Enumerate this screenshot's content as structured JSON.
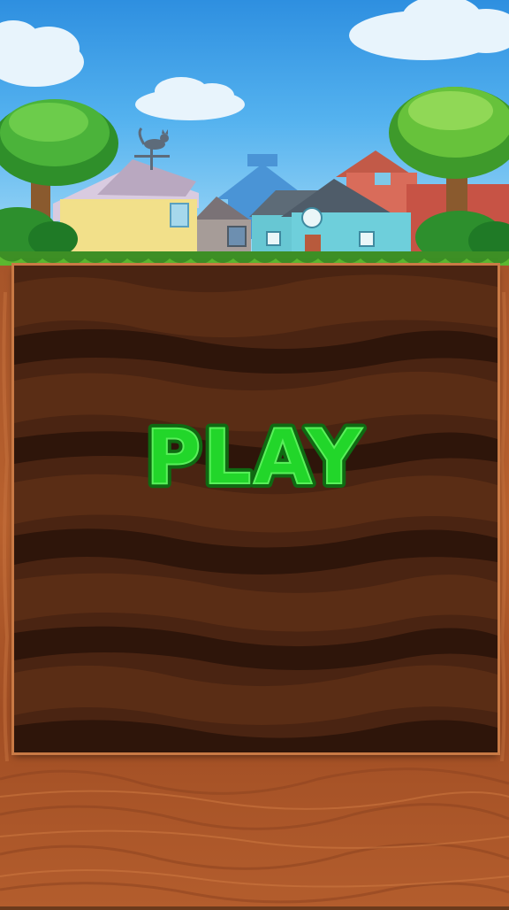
{
  "scene": {
    "play_label": "PLAY"
  },
  "colors": {
    "sky_top": "#2e8fe0",
    "sky_bottom": "#a9ddf7",
    "grass": "#4fae2c",
    "dirt_dark": "#3a1c0d",
    "dirt_frame": "#b35d2d",
    "play_fill": "#22d62a",
    "play_outline": "#0f6a12"
  },
  "icons": [
    "cat-weathervane-icon",
    "tree-icon",
    "house-icon",
    "cloud-icon"
  ]
}
